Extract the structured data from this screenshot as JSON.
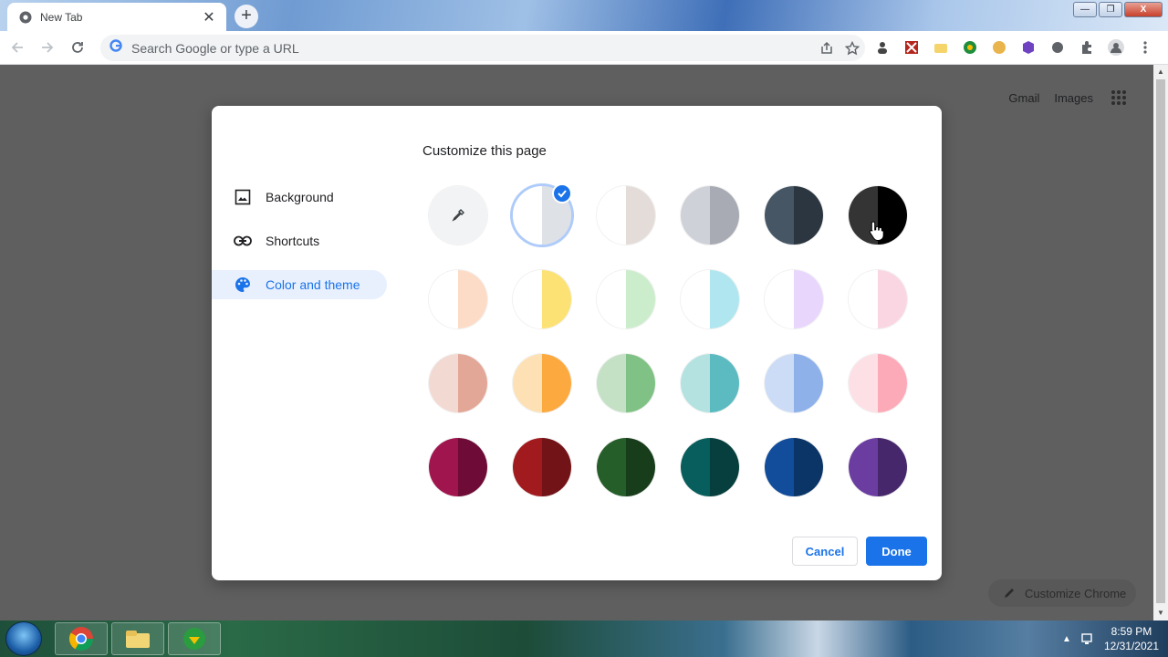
{
  "tab": {
    "title": "New Tab",
    "close": "✕"
  },
  "window_controls": {
    "minimize": "—",
    "maximize": "❐",
    "close": "X"
  },
  "omnibox": {
    "placeholder": "Search Google or type a URL"
  },
  "page": {
    "gmail": "Gmail",
    "images": "Images",
    "customize_chrome": "Customize Chrome"
  },
  "dialog": {
    "title": "Customize this page",
    "sidebar": [
      {
        "label": "Background",
        "icon": "image-icon"
      },
      {
        "label": "Shortcuts",
        "icon": "link-icon"
      },
      {
        "label": "Color and theme",
        "icon": "palette-icon",
        "active": true
      }
    ],
    "swatches": [
      {
        "name": "custom-color-picker",
        "left": "#f1f3f4",
        "right": "#f1f3f4"
      },
      {
        "name": "default",
        "left": "#ffffff",
        "right": "#dee1e6",
        "selected": true
      },
      {
        "name": "warm-grey",
        "left": "#ffffff",
        "right": "#e4dcd8"
      },
      {
        "name": "cool-grey",
        "left": "#cfd1d8",
        "right": "#a8abb3"
      },
      {
        "name": "midnight-blue",
        "left": "#465665",
        "right": "#2b3640"
      },
      {
        "name": "black",
        "left": "#343434",
        "right": "#000000"
      },
      {
        "name": "beige-white",
        "left": "#ffffff",
        "right": "#fcdcc7"
      },
      {
        "name": "yellow-white",
        "left": "#ffffff",
        "right": "#fce274"
      },
      {
        "name": "green-white",
        "left": "#ffffff",
        "right": "#ccedcb"
      },
      {
        "name": "light-teal-white",
        "left": "#ffffff",
        "right": "#b0e6ef"
      },
      {
        "name": "light-purple-white",
        "left": "#ffffff",
        "right": "#e8d6fc"
      },
      {
        "name": "pink-white",
        "left": "#ffffff",
        "right": "#fad6e3"
      },
      {
        "name": "peach",
        "left": "#f2d9d1",
        "right": "#e3a798"
      },
      {
        "name": "orange",
        "left": "#fde0b4",
        "right": "#fca940"
      },
      {
        "name": "light-green",
        "left": "#c4e1c6",
        "right": "#80c285"
      },
      {
        "name": "light-teal",
        "left": "#b3e2e1",
        "right": "#5bbbc0"
      },
      {
        "name": "light-blue",
        "left": "#ccdcf7",
        "right": "#8fb1ea"
      },
      {
        "name": "light-pink",
        "left": "#fde0e6",
        "right": "#fcaab8"
      },
      {
        "name": "dark-pink-red",
        "left": "#a0154e",
        "right": "#6e0b36"
      },
      {
        "name": "dark-red-orange",
        "left": "#a11a1e",
        "right": "#711317"
      },
      {
        "name": "dark-green",
        "left": "#265e2a",
        "right": "#183d1b"
      },
      {
        "name": "dark-teal",
        "left": "#075e5c",
        "right": "#063f3e"
      },
      {
        "name": "dark-blue",
        "left": "#114d9b",
        "right": "#0b3567"
      },
      {
        "name": "dark-purple",
        "left": "#6c3da0",
        "right": "#47276b"
      }
    ],
    "cancel": "Cancel",
    "done": "Done"
  },
  "taskbar": {
    "time": "8:59 PM",
    "date": "12/31/2021"
  },
  "colors": {
    "accent": "#1a73e8",
    "dialog_bg": "#ffffff",
    "scrim": "#5f5f5f"
  }
}
